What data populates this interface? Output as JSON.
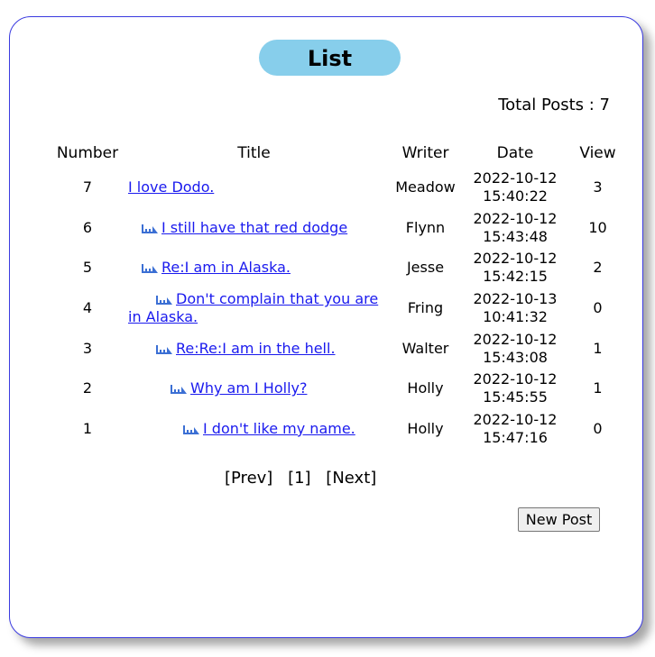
{
  "board": {
    "title": "List",
    "total_label": "Total Posts : 7",
    "columns": [
      "Number",
      "Title",
      "Writer",
      "Date",
      "View"
    ],
    "posts": [
      {
        "number": "7",
        "title": "I love Dodo.",
        "depth": 0,
        "writer": "Meadow",
        "date": "2022-10-12",
        "time": "15:40:22",
        "views": "3"
      },
      {
        "number": "6",
        "title": "I still have that red dodge",
        "depth": 1,
        "writer": "Flynn",
        "date": "2022-10-12",
        "time": "15:43:48",
        "views": "10"
      },
      {
        "number": "5",
        "title": "Re:I am in Alaska.",
        "depth": 1,
        "writer": "Jesse",
        "date": "2022-10-12",
        "time": "15:42:15",
        "views": "2"
      },
      {
        "number": "4",
        "title": "Don't complain that you are in Alaska.",
        "depth": 2,
        "writer": "Fring",
        "date": "2022-10-13",
        "time": "10:41:32",
        "views": "0"
      },
      {
        "number": "3",
        "title": "Re:Re:I am in the hell.",
        "depth": 2,
        "writer": "Walter",
        "date": "2022-10-12",
        "time": "15:43:08",
        "views": "1"
      },
      {
        "number": "2",
        "title": "Why am I Holly?",
        "depth": 3,
        "writer": "Holly",
        "date": "2022-10-12",
        "time": "15:45:55",
        "views": "1"
      },
      {
        "number": "1",
        "title": "I don't like my name.",
        "depth": 4,
        "writer": "Holly",
        "date": "2022-10-12",
        "time": "15:47:16",
        "views": "0"
      }
    ],
    "reply_icon": "reply-arrow-icon",
    "link_color": "#1a1aee",
    "accent_color": "#87ceeb",
    "border_color": "#3a3ae0"
  },
  "pager": {
    "prev": "[Prev]",
    "pages": [
      "[1]"
    ],
    "next": "[Next]"
  },
  "actions": {
    "new_post_label": "New Post"
  }
}
